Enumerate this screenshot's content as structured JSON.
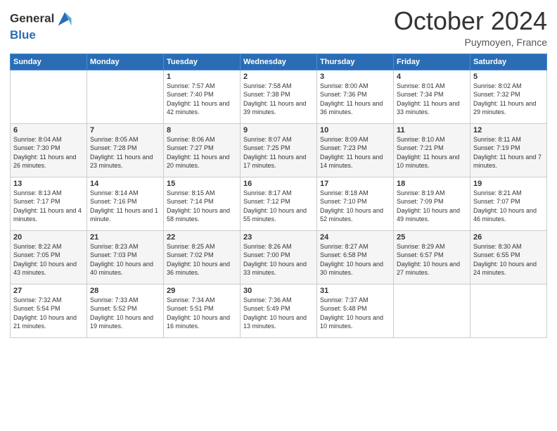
{
  "logo": {
    "line1": "General",
    "line2": "Blue"
  },
  "title": "October 2024",
  "subtitle": "Puymoyen, France",
  "header_days": [
    "Sunday",
    "Monday",
    "Tuesday",
    "Wednesday",
    "Thursday",
    "Friday",
    "Saturday"
  ],
  "weeks": [
    [
      {
        "day": "",
        "sunrise": "",
        "sunset": "",
        "daylight": ""
      },
      {
        "day": "",
        "sunrise": "",
        "sunset": "",
        "daylight": ""
      },
      {
        "day": "1",
        "sunrise": "Sunrise: 7:57 AM",
        "sunset": "Sunset: 7:40 PM",
        "daylight": "Daylight: 11 hours and 42 minutes."
      },
      {
        "day": "2",
        "sunrise": "Sunrise: 7:58 AM",
        "sunset": "Sunset: 7:38 PM",
        "daylight": "Daylight: 11 hours and 39 minutes."
      },
      {
        "day": "3",
        "sunrise": "Sunrise: 8:00 AM",
        "sunset": "Sunset: 7:36 PM",
        "daylight": "Daylight: 11 hours and 36 minutes."
      },
      {
        "day": "4",
        "sunrise": "Sunrise: 8:01 AM",
        "sunset": "Sunset: 7:34 PM",
        "daylight": "Daylight: 11 hours and 33 minutes."
      },
      {
        "day": "5",
        "sunrise": "Sunrise: 8:02 AM",
        "sunset": "Sunset: 7:32 PM",
        "daylight": "Daylight: 11 hours and 29 minutes."
      }
    ],
    [
      {
        "day": "6",
        "sunrise": "Sunrise: 8:04 AM",
        "sunset": "Sunset: 7:30 PM",
        "daylight": "Daylight: 11 hours and 26 minutes."
      },
      {
        "day": "7",
        "sunrise": "Sunrise: 8:05 AM",
        "sunset": "Sunset: 7:28 PM",
        "daylight": "Daylight: 11 hours and 23 minutes."
      },
      {
        "day": "8",
        "sunrise": "Sunrise: 8:06 AM",
        "sunset": "Sunset: 7:27 PM",
        "daylight": "Daylight: 11 hours and 20 minutes."
      },
      {
        "day": "9",
        "sunrise": "Sunrise: 8:07 AM",
        "sunset": "Sunset: 7:25 PM",
        "daylight": "Daylight: 11 hours and 17 minutes."
      },
      {
        "day": "10",
        "sunrise": "Sunrise: 8:09 AM",
        "sunset": "Sunset: 7:23 PM",
        "daylight": "Daylight: 11 hours and 14 minutes."
      },
      {
        "day": "11",
        "sunrise": "Sunrise: 8:10 AM",
        "sunset": "Sunset: 7:21 PM",
        "daylight": "Daylight: 11 hours and 10 minutes."
      },
      {
        "day": "12",
        "sunrise": "Sunrise: 8:11 AM",
        "sunset": "Sunset: 7:19 PM",
        "daylight": "Daylight: 11 hours and 7 minutes."
      }
    ],
    [
      {
        "day": "13",
        "sunrise": "Sunrise: 8:13 AM",
        "sunset": "Sunset: 7:17 PM",
        "daylight": "Daylight: 11 hours and 4 minutes."
      },
      {
        "day": "14",
        "sunrise": "Sunrise: 8:14 AM",
        "sunset": "Sunset: 7:16 PM",
        "daylight": "Daylight: 11 hours and 1 minute."
      },
      {
        "day": "15",
        "sunrise": "Sunrise: 8:15 AM",
        "sunset": "Sunset: 7:14 PM",
        "daylight": "Daylight: 10 hours and 58 minutes."
      },
      {
        "day": "16",
        "sunrise": "Sunrise: 8:17 AM",
        "sunset": "Sunset: 7:12 PM",
        "daylight": "Daylight: 10 hours and 55 minutes."
      },
      {
        "day": "17",
        "sunrise": "Sunrise: 8:18 AM",
        "sunset": "Sunset: 7:10 PM",
        "daylight": "Daylight: 10 hours and 52 minutes."
      },
      {
        "day": "18",
        "sunrise": "Sunrise: 8:19 AM",
        "sunset": "Sunset: 7:09 PM",
        "daylight": "Daylight: 10 hours and 49 minutes."
      },
      {
        "day": "19",
        "sunrise": "Sunrise: 8:21 AM",
        "sunset": "Sunset: 7:07 PM",
        "daylight": "Daylight: 10 hours and 46 minutes."
      }
    ],
    [
      {
        "day": "20",
        "sunrise": "Sunrise: 8:22 AM",
        "sunset": "Sunset: 7:05 PM",
        "daylight": "Daylight: 10 hours and 43 minutes."
      },
      {
        "day": "21",
        "sunrise": "Sunrise: 8:23 AM",
        "sunset": "Sunset: 7:03 PM",
        "daylight": "Daylight: 10 hours and 40 minutes."
      },
      {
        "day": "22",
        "sunrise": "Sunrise: 8:25 AM",
        "sunset": "Sunset: 7:02 PM",
        "daylight": "Daylight: 10 hours and 36 minutes."
      },
      {
        "day": "23",
        "sunrise": "Sunrise: 8:26 AM",
        "sunset": "Sunset: 7:00 PM",
        "daylight": "Daylight: 10 hours and 33 minutes."
      },
      {
        "day": "24",
        "sunrise": "Sunrise: 8:27 AM",
        "sunset": "Sunset: 6:58 PM",
        "daylight": "Daylight: 10 hours and 30 minutes."
      },
      {
        "day": "25",
        "sunrise": "Sunrise: 8:29 AM",
        "sunset": "Sunset: 6:57 PM",
        "daylight": "Daylight: 10 hours and 27 minutes."
      },
      {
        "day": "26",
        "sunrise": "Sunrise: 8:30 AM",
        "sunset": "Sunset: 6:55 PM",
        "daylight": "Daylight: 10 hours and 24 minutes."
      }
    ],
    [
      {
        "day": "27",
        "sunrise": "Sunrise: 7:32 AM",
        "sunset": "Sunset: 5:54 PM",
        "daylight": "Daylight: 10 hours and 21 minutes."
      },
      {
        "day": "28",
        "sunrise": "Sunrise: 7:33 AM",
        "sunset": "Sunset: 5:52 PM",
        "daylight": "Daylight: 10 hours and 19 minutes."
      },
      {
        "day": "29",
        "sunrise": "Sunrise: 7:34 AM",
        "sunset": "Sunset: 5:51 PM",
        "daylight": "Daylight: 10 hours and 16 minutes."
      },
      {
        "day": "30",
        "sunrise": "Sunrise: 7:36 AM",
        "sunset": "Sunset: 5:49 PM",
        "daylight": "Daylight: 10 hours and 13 minutes."
      },
      {
        "day": "31",
        "sunrise": "Sunrise: 7:37 AM",
        "sunset": "Sunset: 5:48 PM",
        "daylight": "Daylight: 10 hours and 10 minutes."
      },
      {
        "day": "",
        "sunrise": "",
        "sunset": "",
        "daylight": ""
      },
      {
        "day": "",
        "sunrise": "",
        "sunset": "",
        "daylight": ""
      }
    ]
  ]
}
